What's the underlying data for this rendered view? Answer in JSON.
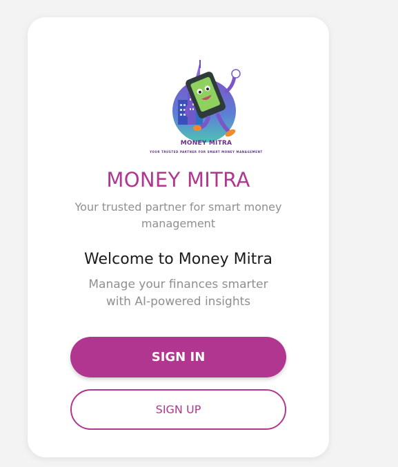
{
  "logo": {
    "wordmark": "MONEY MITRA",
    "tagline": "YOUR TRUSTED PARTNER FOR SMART MONEY MANAGEMENT"
  },
  "brand": {
    "title": "MONEY MITRA",
    "subtitle": "Your trusted partner for smart money management"
  },
  "welcome": {
    "heading": "Welcome to Money Mitra",
    "text": "Manage your finances smarter with AI-powered insights"
  },
  "actions": {
    "sign_in_label": "SIGN IN",
    "sign_up_label": "SIGN UP"
  },
  "colors": {
    "accent": "#b1368f",
    "background": "#f3f3f3",
    "card": "#ffffff",
    "muted_text": "#8f8f8f"
  }
}
